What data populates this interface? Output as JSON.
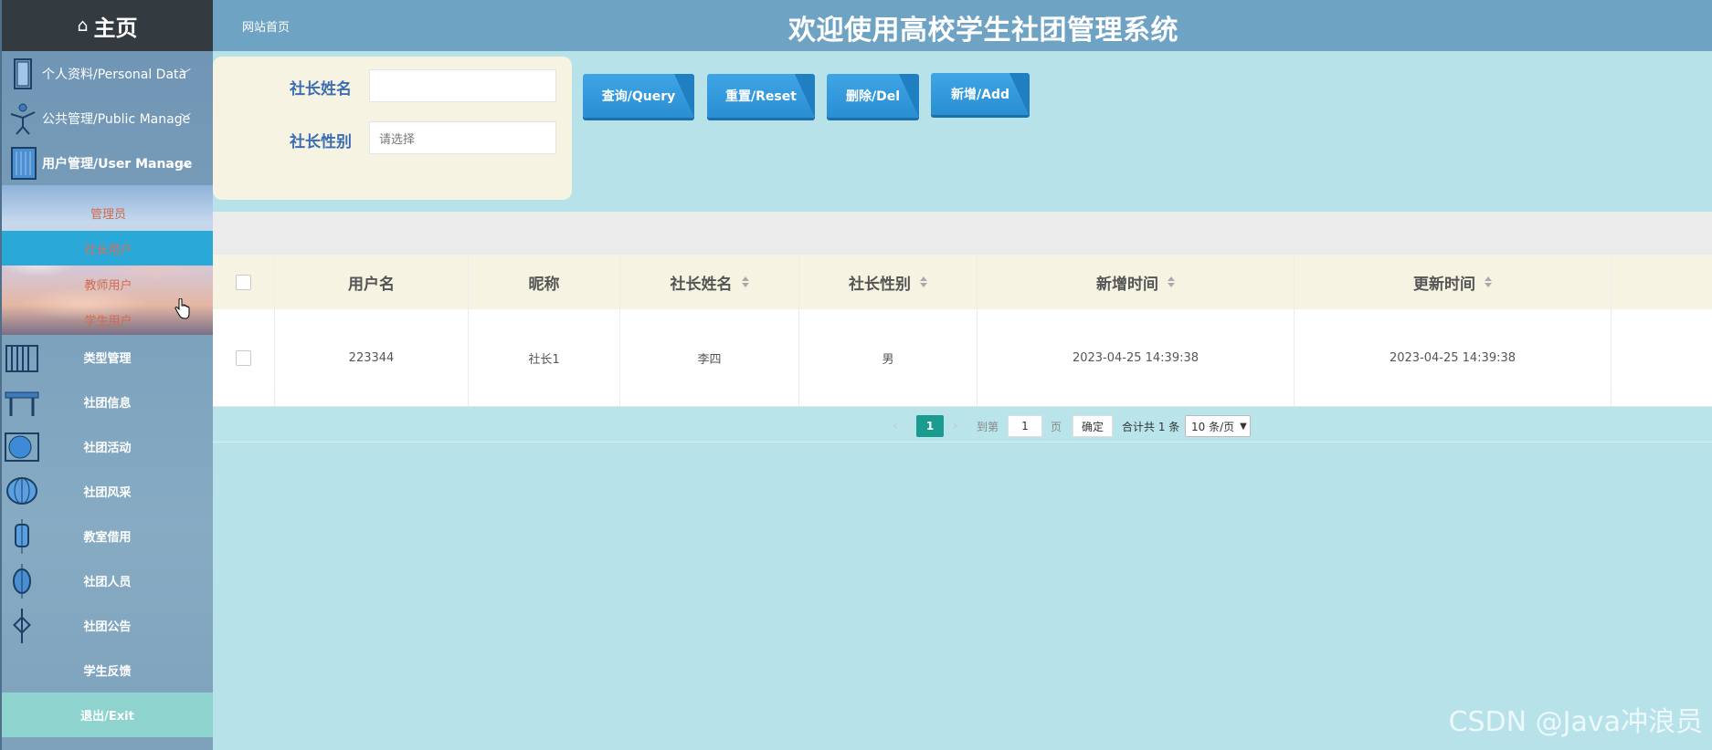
{
  "sidebar": {
    "home": "主页",
    "groups": [
      {
        "label": "个人资料/Personal Data",
        "chevron": "down"
      },
      {
        "label": "公共管理/Public Manage",
        "chevron": "down"
      },
      {
        "label": "用户管理/User Manage",
        "chevron": "up"
      }
    ],
    "sub_items": [
      "管理员",
      "社长用户",
      "教师用户",
      "学生用户"
    ],
    "active_sub": "社长用户",
    "items": [
      "类型管理",
      "社团信息",
      "社团活动",
      "社团风采",
      "教室借用",
      "社团人员",
      "社团公告",
      "学生反馈"
    ],
    "exit": "退出/Exit"
  },
  "topbar": {
    "breadcrumb": "网站首页",
    "title": "欢迎使用高校学生社团管理系统"
  },
  "search": {
    "name_label": "社长姓名",
    "name_value": "",
    "gender_label": "社长性别",
    "gender_placeholder": "请选择"
  },
  "buttons": {
    "query": "查询/Query",
    "reset": "重置/Reset",
    "delete": "删除/Del",
    "add": "新增/Add"
  },
  "table": {
    "columns": [
      "用户名",
      "昵称",
      "社长姓名",
      "社长性别",
      "新增时间",
      "更新时间"
    ],
    "rows": [
      {
        "username": "223344",
        "nickname": "社长1",
        "name": "李四",
        "gender": "男",
        "created": "2023-04-25 14:39:38",
        "updated": "2023-04-25 14:39:38"
      }
    ]
  },
  "pagination": {
    "current": "1",
    "goto_label": "到第",
    "goto_value": "1",
    "page_unit": "页",
    "confirm": "确定",
    "total": "合计共 1 条",
    "page_size": "10 条/页"
  },
  "watermark": "CSDN @Java冲浪员",
  "colors": {
    "accent": "#2aa8d8",
    "button": "#2a8ed3",
    "pager_active": "#1a9b8f",
    "background": "#b7e2e9",
    "label": "#3b6eb5"
  }
}
